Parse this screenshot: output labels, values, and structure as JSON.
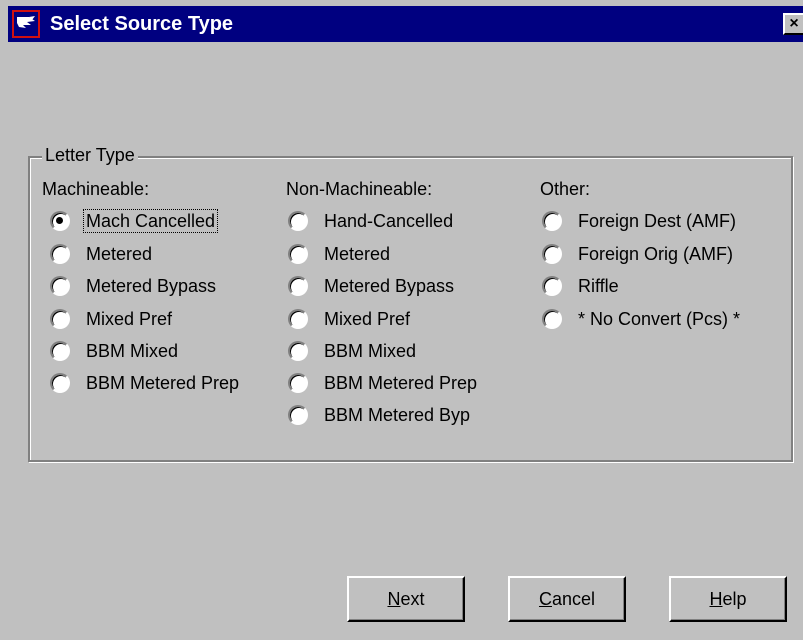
{
  "window": {
    "title": "Select Source Type",
    "close_label": "×"
  },
  "group": {
    "legend": "Letter Type"
  },
  "columns": [
    {
      "header": "Machineable:",
      "options": [
        {
          "label": "Mach Cancelled",
          "checked": true,
          "focused": true
        },
        {
          "label": "Metered",
          "checked": false
        },
        {
          "label": "Metered Bypass",
          "checked": false
        },
        {
          "label": "Mixed Pref",
          "checked": false
        },
        {
          "label": "BBM Mixed",
          "checked": false
        },
        {
          "label": "BBM Metered Prep",
          "checked": false
        }
      ]
    },
    {
      "header": "Non-Machineable:",
      "options": [
        {
          "label": "Hand-Cancelled",
          "checked": false
        },
        {
          "label": "Metered",
          "checked": false
        },
        {
          "label": "Metered Bypass",
          "checked": false
        },
        {
          "label": "Mixed Pref",
          "checked": false
        },
        {
          "label": "BBM Mixed",
          "checked": false
        },
        {
          "label": "BBM Metered Prep",
          "checked": false
        },
        {
          "label": "BBM Metered Byp",
          "checked": false
        }
      ]
    },
    {
      "header": "Other:",
      "options": [
        {
          "label": "Foreign Dest (AMF)",
          "checked": false
        },
        {
          "label": "Foreign Orig (AMF)",
          "checked": false
        },
        {
          "label": "Riffle",
          "checked": false
        },
        {
          "label": "* No Convert (Pcs) *",
          "checked": false
        }
      ]
    }
  ],
  "buttons": {
    "next": {
      "accel": "N",
      "rest": "ext"
    },
    "cancel": {
      "accel": "C",
      "rest": "ancel"
    },
    "help": {
      "accel": "H",
      "rest": "elp"
    }
  },
  "icons": {
    "app": "eagle-logo-icon",
    "close": "close-icon"
  }
}
